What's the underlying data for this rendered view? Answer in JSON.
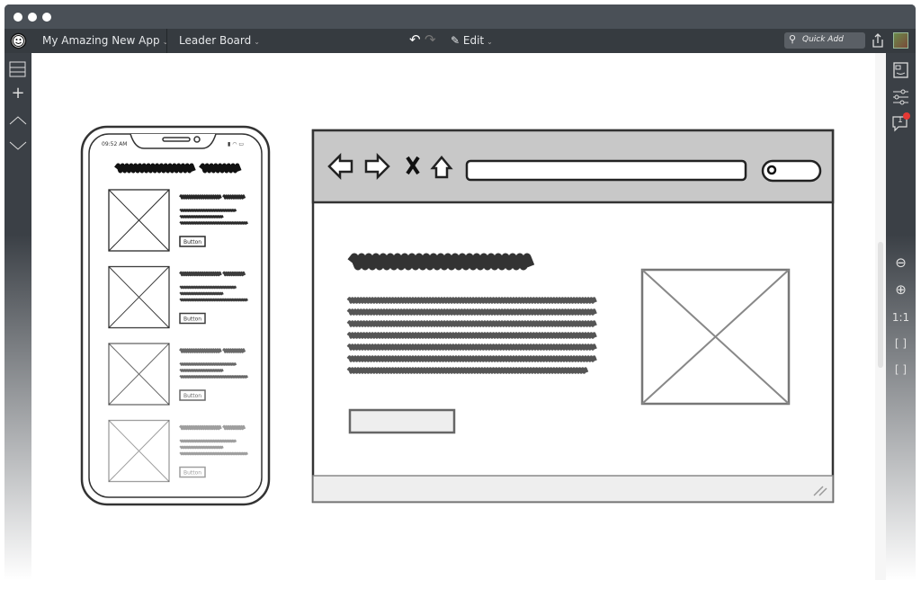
{
  "window": {
    "controls": [
      "close",
      "minimize",
      "maximize"
    ]
  },
  "toolbar": {
    "app_icon": "smiley-logo-icon",
    "project": "My Amazing New App",
    "page": "Leader Board",
    "undo_icon": "undo-icon",
    "redo_icon": "redo-icon",
    "edit_label": "Edit",
    "quick_add_placeholder": "Quick Add",
    "share_icon": "share-icon",
    "avatar": "user-avatar"
  },
  "left_sidebar": {
    "icons": [
      "layout-icon",
      "plus-icon",
      "chevron-up-icon",
      "chevron-down-icon"
    ]
  },
  "right_sidebar": {
    "icons": [
      "properties-icon",
      "settings-sliders-icon",
      "comments-icon"
    ],
    "comment_count": "1",
    "zoom_out_icon": "zoom-out-icon",
    "zoom_in_icon": "zoom-in-icon",
    "actual_size": "1:1",
    "fit_label": "[ ]",
    "fullscreen_label": "[ ]"
  },
  "phone": {
    "time": "09:52 AM",
    "items": [
      {
        "button": "Button"
      },
      {
        "button": "Button"
      },
      {
        "button": "Button"
      },
      {
        "button": "Button"
      }
    ]
  },
  "browser": {
    "icons": [
      "back-arrow-icon",
      "forward-arrow-icon",
      "close-x-icon",
      "home-icon",
      "search-icon"
    ]
  },
  "colors": {
    "titlebar": "#4a5057",
    "toolbar": "#363b40",
    "notification": "#e53935",
    "browser_header": "#c8c8c8"
  }
}
